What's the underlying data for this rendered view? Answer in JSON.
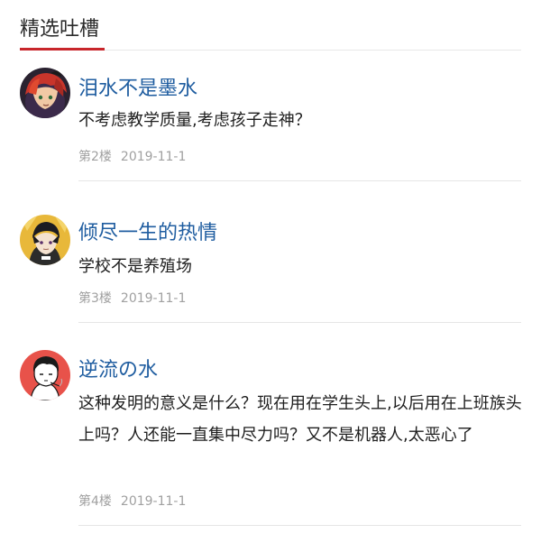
{
  "section": {
    "title": "精选吐槽"
  },
  "comments": [
    {
      "user": "泪水不是墨水",
      "text": "不考虑教学质量,考虑孩子走神？",
      "floor": "第2楼",
      "date": "2019-11-1",
      "avatar_icon": "anime-avatar-red-hair-icon"
    },
    {
      "user": "倾尽一生的热情",
      "text": "学校不是养殖场",
      "floor": "第3楼",
      "date": "2019-11-1",
      "avatar_icon": "anime-avatar-yellow-bg-icon"
    },
    {
      "user": "逆流の水",
      "text": "这种发明的意义是什么？现在用在学生头上,以后用在上班族头上吗？人还能一直集中尽力吗？又不是机器人,太恶心了",
      "floor": "第4楼",
      "date": "2019-11-1",
      "avatar_icon": "sketch-avatar-red-bg-icon"
    }
  ],
  "colors": {
    "accent": "#c8262b",
    "username": "#1f5da0",
    "meta": "#a0a0a0",
    "divider": "#e6e6e6"
  }
}
